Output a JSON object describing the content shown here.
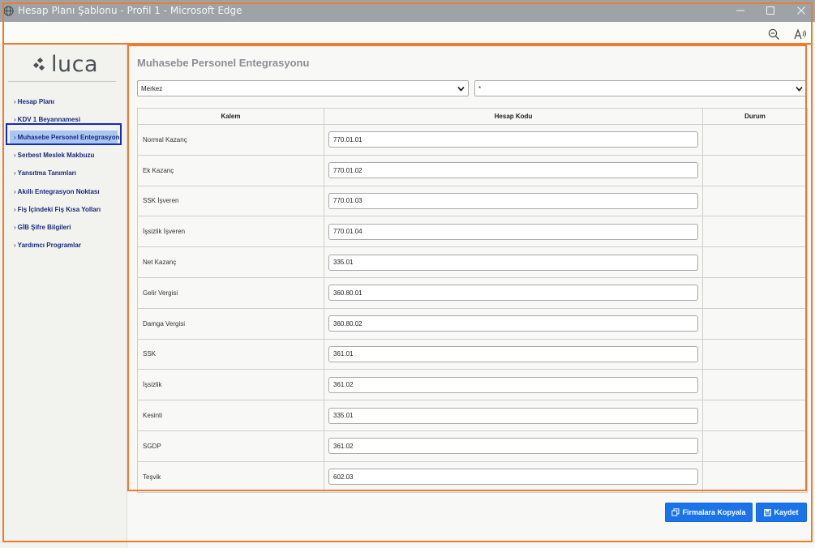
{
  "window": {
    "title": "Hesap Planı Şablonu - Profil 1 - Microsoft Edge",
    "icon": "globe-icon",
    "controls": [
      "minimize-icon",
      "maximize-icon",
      "close-icon"
    ]
  },
  "toolbar": {
    "icons": [
      "zoom-out-icon",
      "read-aloud-icon"
    ]
  },
  "sidebar": {
    "logo": "luca",
    "items": [
      {
        "label": "Hesap Planı"
      },
      {
        "label": "KDV 1 Beyannamesi"
      },
      {
        "label": "Muhasebe Personel Entegrasyon",
        "active": true
      },
      {
        "label": "Serbest Meslek Makbuzu"
      },
      {
        "label": "Yansıtma Tanımları"
      },
      {
        "label": "Akıllı Entegrasyon Noktası"
      },
      {
        "label": "Fiş İçindeki Fiş Kısa Yolları"
      },
      {
        "label": "GİB Şifre Bilgileri"
      },
      {
        "label": "Yardımcı Programlar"
      }
    ]
  },
  "main": {
    "title": "Muhasebe Personel Entegrasyonu",
    "select_branch": "Merkez",
    "select_second": "*",
    "columns": [
      "Kalem",
      "Hesap Kodu",
      "Durum"
    ],
    "rows": [
      {
        "kalem": "Normal Kazanç",
        "hesap_kodu": "770.01.01",
        "durum": ""
      },
      {
        "kalem": "Ek Kazanç",
        "hesap_kodu": "770.01.02",
        "durum": ""
      },
      {
        "kalem": "SSK İşveren",
        "hesap_kodu": "770.01.03",
        "durum": ""
      },
      {
        "kalem": "İşsizlik İşveren",
        "hesap_kodu": "770.01.04",
        "durum": ""
      },
      {
        "kalem": "Net Kazanç",
        "hesap_kodu": "335.01",
        "durum": ""
      },
      {
        "kalem": "Gelir Vergisi",
        "hesap_kodu": "360.80.01",
        "durum": ""
      },
      {
        "kalem": "Damga Vergisi",
        "hesap_kodu": "360.80.02",
        "durum": ""
      },
      {
        "kalem": "SSK",
        "hesap_kodu": "361.01",
        "durum": ""
      },
      {
        "kalem": "İşsizlik",
        "hesap_kodu": "361.02",
        "durum": ""
      },
      {
        "kalem": "Kesinti",
        "hesap_kodu": "335.01",
        "durum": ""
      },
      {
        "kalem": "SGDP",
        "hesap_kodu": "361.02",
        "durum": ""
      },
      {
        "kalem": "Teşvik",
        "hesap_kodu": "602.03",
        "durum": ""
      }
    ],
    "buttons": {
      "copy_label": "Firmalara Kopyala",
      "save_label": "Kaydet"
    }
  },
  "colors": {
    "accent": "#1a73e8",
    "nav_text": "#1a2a7a",
    "active_bg": "#a9c7f2",
    "highlight_box": "#1428c8",
    "annotation": "#f07a2d"
  }
}
